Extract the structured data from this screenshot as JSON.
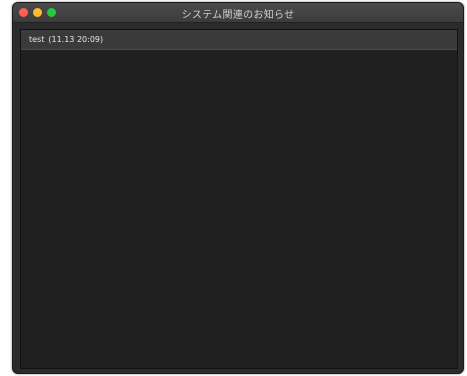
{
  "window": {
    "title": "システム関連のお知らせ",
    "buttons": {
      "close_color": "#ff5f57",
      "minimize_color": "#febc2e",
      "maximize_color": "#28c840"
    }
  },
  "notices": [
    {
      "title": "test",
      "timestamp": "(11.13 20:09)"
    }
  ]
}
